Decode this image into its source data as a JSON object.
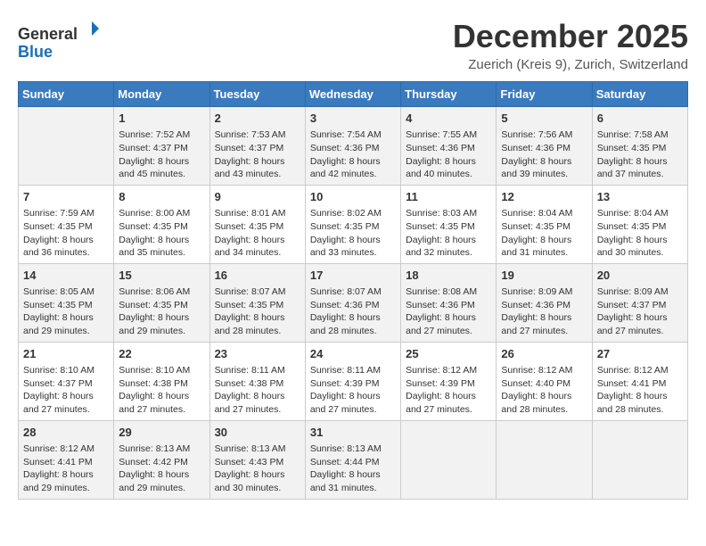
{
  "header": {
    "logo_line1": "General",
    "logo_line2": "Blue",
    "month": "December 2025",
    "location": "Zuerich (Kreis 9), Zurich, Switzerland"
  },
  "weekdays": [
    "Sunday",
    "Monday",
    "Tuesday",
    "Wednesday",
    "Thursday",
    "Friday",
    "Saturday"
  ],
  "weeks": [
    [
      {
        "day": "",
        "content": ""
      },
      {
        "day": "1",
        "content": "Sunrise: 7:52 AM\nSunset: 4:37 PM\nDaylight: 8 hours\nand 45 minutes."
      },
      {
        "day": "2",
        "content": "Sunrise: 7:53 AM\nSunset: 4:37 PM\nDaylight: 8 hours\nand 43 minutes."
      },
      {
        "day": "3",
        "content": "Sunrise: 7:54 AM\nSunset: 4:36 PM\nDaylight: 8 hours\nand 42 minutes."
      },
      {
        "day": "4",
        "content": "Sunrise: 7:55 AM\nSunset: 4:36 PM\nDaylight: 8 hours\nand 40 minutes."
      },
      {
        "day": "5",
        "content": "Sunrise: 7:56 AM\nSunset: 4:36 PM\nDaylight: 8 hours\nand 39 minutes."
      },
      {
        "day": "6",
        "content": "Sunrise: 7:58 AM\nSunset: 4:35 PM\nDaylight: 8 hours\nand 37 minutes."
      }
    ],
    [
      {
        "day": "7",
        "content": "Sunrise: 7:59 AM\nSunset: 4:35 PM\nDaylight: 8 hours\nand 36 minutes."
      },
      {
        "day": "8",
        "content": "Sunrise: 8:00 AM\nSunset: 4:35 PM\nDaylight: 8 hours\nand 35 minutes."
      },
      {
        "day": "9",
        "content": "Sunrise: 8:01 AM\nSunset: 4:35 PM\nDaylight: 8 hours\nand 34 minutes."
      },
      {
        "day": "10",
        "content": "Sunrise: 8:02 AM\nSunset: 4:35 PM\nDaylight: 8 hours\nand 33 minutes."
      },
      {
        "day": "11",
        "content": "Sunrise: 8:03 AM\nSunset: 4:35 PM\nDaylight: 8 hours\nand 32 minutes."
      },
      {
        "day": "12",
        "content": "Sunrise: 8:04 AM\nSunset: 4:35 PM\nDaylight: 8 hours\nand 31 minutes."
      },
      {
        "day": "13",
        "content": "Sunrise: 8:04 AM\nSunset: 4:35 PM\nDaylight: 8 hours\nand 30 minutes."
      }
    ],
    [
      {
        "day": "14",
        "content": "Sunrise: 8:05 AM\nSunset: 4:35 PM\nDaylight: 8 hours\nand 29 minutes."
      },
      {
        "day": "15",
        "content": "Sunrise: 8:06 AM\nSunset: 4:35 PM\nDaylight: 8 hours\nand 29 minutes."
      },
      {
        "day": "16",
        "content": "Sunrise: 8:07 AM\nSunset: 4:35 PM\nDaylight: 8 hours\nand 28 minutes."
      },
      {
        "day": "17",
        "content": "Sunrise: 8:07 AM\nSunset: 4:36 PM\nDaylight: 8 hours\nand 28 minutes."
      },
      {
        "day": "18",
        "content": "Sunrise: 8:08 AM\nSunset: 4:36 PM\nDaylight: 8 hours\nand 27 minutes."
      },
      {
        "day": "19",
        "content": "Sunrise: 8:09 AM\nSunset: 4:36 PM\nDaylight: 8 hours\nand 27 minutes."
      },
      {
        "day": "20",
        "content": "Sunrise: 8:09 AM\nSunset: 4:37 PM\nDaylight: 8 hours\nand 27 minutes."
      }
    ],
    [
      {
        "day": "21",
        "content": "Sunrise: 8:10 AM\nSunset: 4:37 PM\nDaylight: 8 hours\nand 27 minutes."
      },
      {
        "day": "22",
        "content": "Sunrise: 8:10 AM\nSunset: 4:38 PM\nDaylight: 8 hours\nand 27 minutes."
      },
      {
        "day": "23",
        "content": "Sunrise: 8:11 AM\nSunset: 4:38 PM\nDaylight: 8 hours\nand 27 minutes."
      },
      {
        "day": "24",
        "content": "Sunrise: 8:11 AM\nSunset: 4:39 PM\nDaylight: 8 hours\nand 27 minutes."
      },
      {
        "day": "25",
        "content": "Sunrise: 8:12 AM\nSunset: 4:39 PM\nDaylight: 8 hours\nand 27 minutes."
      },
      {
        "day": "26",
        "content": "Sunrise: 8:12 AM\nSunset: 4:40 PM\nDaylight: 8 hours\nand 28 minutes."
      },
      {
        "day": "27",
        "content": "Sunrise: 8:12 AM\nSunset: 4:41 PM\nDaylight: 8 hours\nand 28 minutes."
      }
    ],
    [
      {
        "day": "28",
        "content": "Sunrise: 8:12 AM\nSunset: 4:41 PM\nDaylight: 8 hours\nand 29 minutes."
      },
      {
        "day": "29",
        "content": "Sunrise: 8:13 AM\nSunset: 4:42 PM\nDaylight: 8 hours\nand 29 minutes."
      },
      {
        "day": "30",
        "content": "Sunrise: 8:13 AM\nSunset: 4:43 PM\nDaylight: 8 hours\nand 30 minutes."
      },
      {
        "day": "31",
        "content": "Sunrise: 8:13 AM\nSunset: 4:44 PM\nDaylight: 8 hours\nand 31 minutes."
      },
      {
        "day": "",
        "content": ""
      },
      {
        "day": "",
        "content": ""
      },
      {
        "day": "",
        "content": ""
      }
    ]
  ]
}
